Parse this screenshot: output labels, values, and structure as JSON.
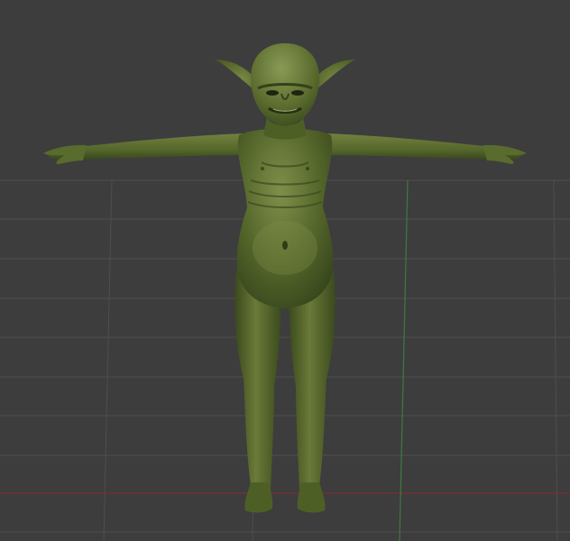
{
  "viewport": {
    "background": "#3d3d3d",
    "grid_color": "#4d4d4d",
    "x_axis_color": "#7a2f36",
    "y_axis_color": "#3f7a3f",
    "model": {
      "name": "goblin-character",
      "pose": "T-pose",
      "skin_color": "#55662b",
      "shade_color": "#3a4a1c",
      "highlight_color": "#7a8a48"
    }
  }
}
